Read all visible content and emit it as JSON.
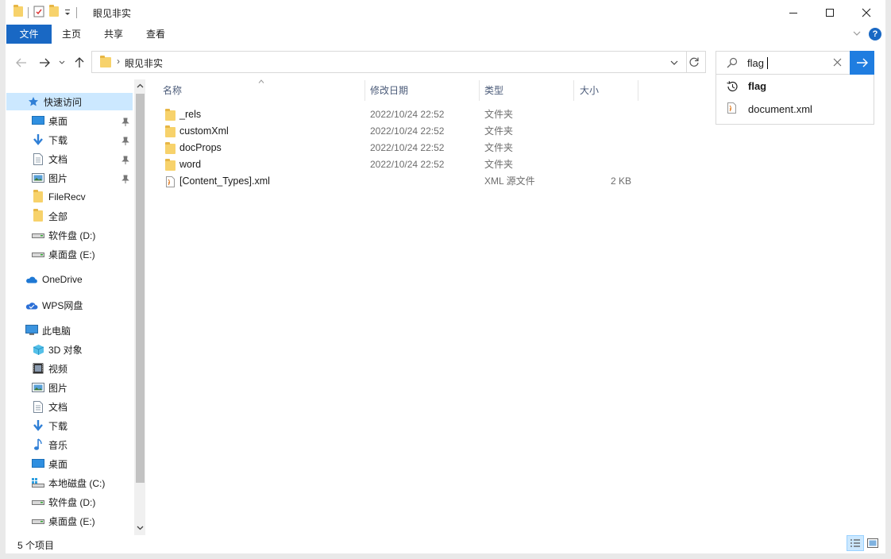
{
  "window": {
    "title": "眼见非实",
    "controls": {
      "minimize": "minimize-icon",
      "maximize": "maximize-icon",
      "close": "close-icon"
    }
  },
  "ribbon": {
    "tabs": [
      "文件",
      "主页",
      "共享",
      "查看"
    ]
  },
  "address": {
    "breadcrumb": "眼见非实"
  },
  "search": {
    "value": "flag",
    "suggestions": [
      {
        "label": "flag",
        "icon": "history-icon"
      },
      {
        "label": "document.xml",
        "icon": "xml-file-icon"
      }
    ]
  },
  "nav": {
    "quick_access": "快速访问",
    "quick_items": [
      {
        "label": "桌面",
        "icon": "desktop-icon",
        "pinned": true
      },
      {
        "label": "下载",
        "icon": "download-icon",
        "pinned": true
      },
      {
        "label": "文档",
        "icon": "document-icon",
        "pinned": true
      },
      {
        "label": "图片",
        "icon": "pictures-icon",
        "pinned": true
      },
      {
        "label": "FileRecv",
        "icon": "folder-icon",
        "pinned": false
      },
      {
        "label": "全部",
        "icon": "folder-icon",
        "pinned": false
      },
      {
        "label": "软件盘 (D:)",
        "icon": "drive-icon",
        "pinned": false
      },
      {
        "label": "桌面盘 (E:)",
        "icon": "drive-icon",
        "pinned": false
      }
    ],
    "onedrive": "OneDrive",
    "wps": "WPS网盘",
    "this_pc": "此电脑",
    "pc_items": [
      {
        "label": "3D 对象",
        "icon": "3d-objects-icon"
      },
      {
        "label": "视频",
        "icon": "videos-icon"
      },
      {
        "label": "图片",
        "icon": "pictures-icon"
      },
      {
        "label": "文档",
        "icon": "document-icon"
      },
      {
        "label": "下载",
        "icon": "download-icon"
      },
      {
        "label": "音乐",
        "icon": "music-icon"
      },
      {
        "label": "桌面",
        "icon": "desktop-icon"
      },
      {
        "label": "本地磁盘 (C:)",
        "icon": "local-disk-icon"
      },
      {
        "label": "软件盘 (D:)",
        "icon": "drive-icon"
      },
      {
        "label": "桌面盘 (E:)",
        "icon": "drive-icon"
      }
    ]
  },
  "columns": {
    "name": "名称",
    "date": "修改日期",
    "type": "类型",
    "size": "大小"
  },
  "files": [
    {
      "name": "_rels",
      "date": "2022/10/24 22:52",
      "type": "文件夹",
      "size": "",
      "icon": "folder-icon"
    },
    {
      "name": "customXml",
      "date": "2022/10/24 22:52",
      "type": "文件夹",
      "size": "",
      "icon": "folder-icon"
    },
    {
      "name": "docProps",
      "date": "2022/10/24 22:52",
      "type": "文件夹",
      "size": "",
      "icon": "folder-icon"
    },
    {
      "name": "word",
      "date": "2022/10/24 22:52",
      "type": "文件夹",
      "size": "",
      "icon": "folder-icon"
    },
    {
      "name": "[Content_Types].xml",
      "date": "",
      "type": "XML 源文件",
      "size": "2 KB",
      "icon": "xml-file-icon"
    }
  ],
  "status": {
    "count": "5 个项目"
  },
  "colors": {
    "accent": "#1968c4",
    "go_button": "#1f7de0",
    "selected": "#cce8ff",
    "folder": "#f7d26b"
  }
}
